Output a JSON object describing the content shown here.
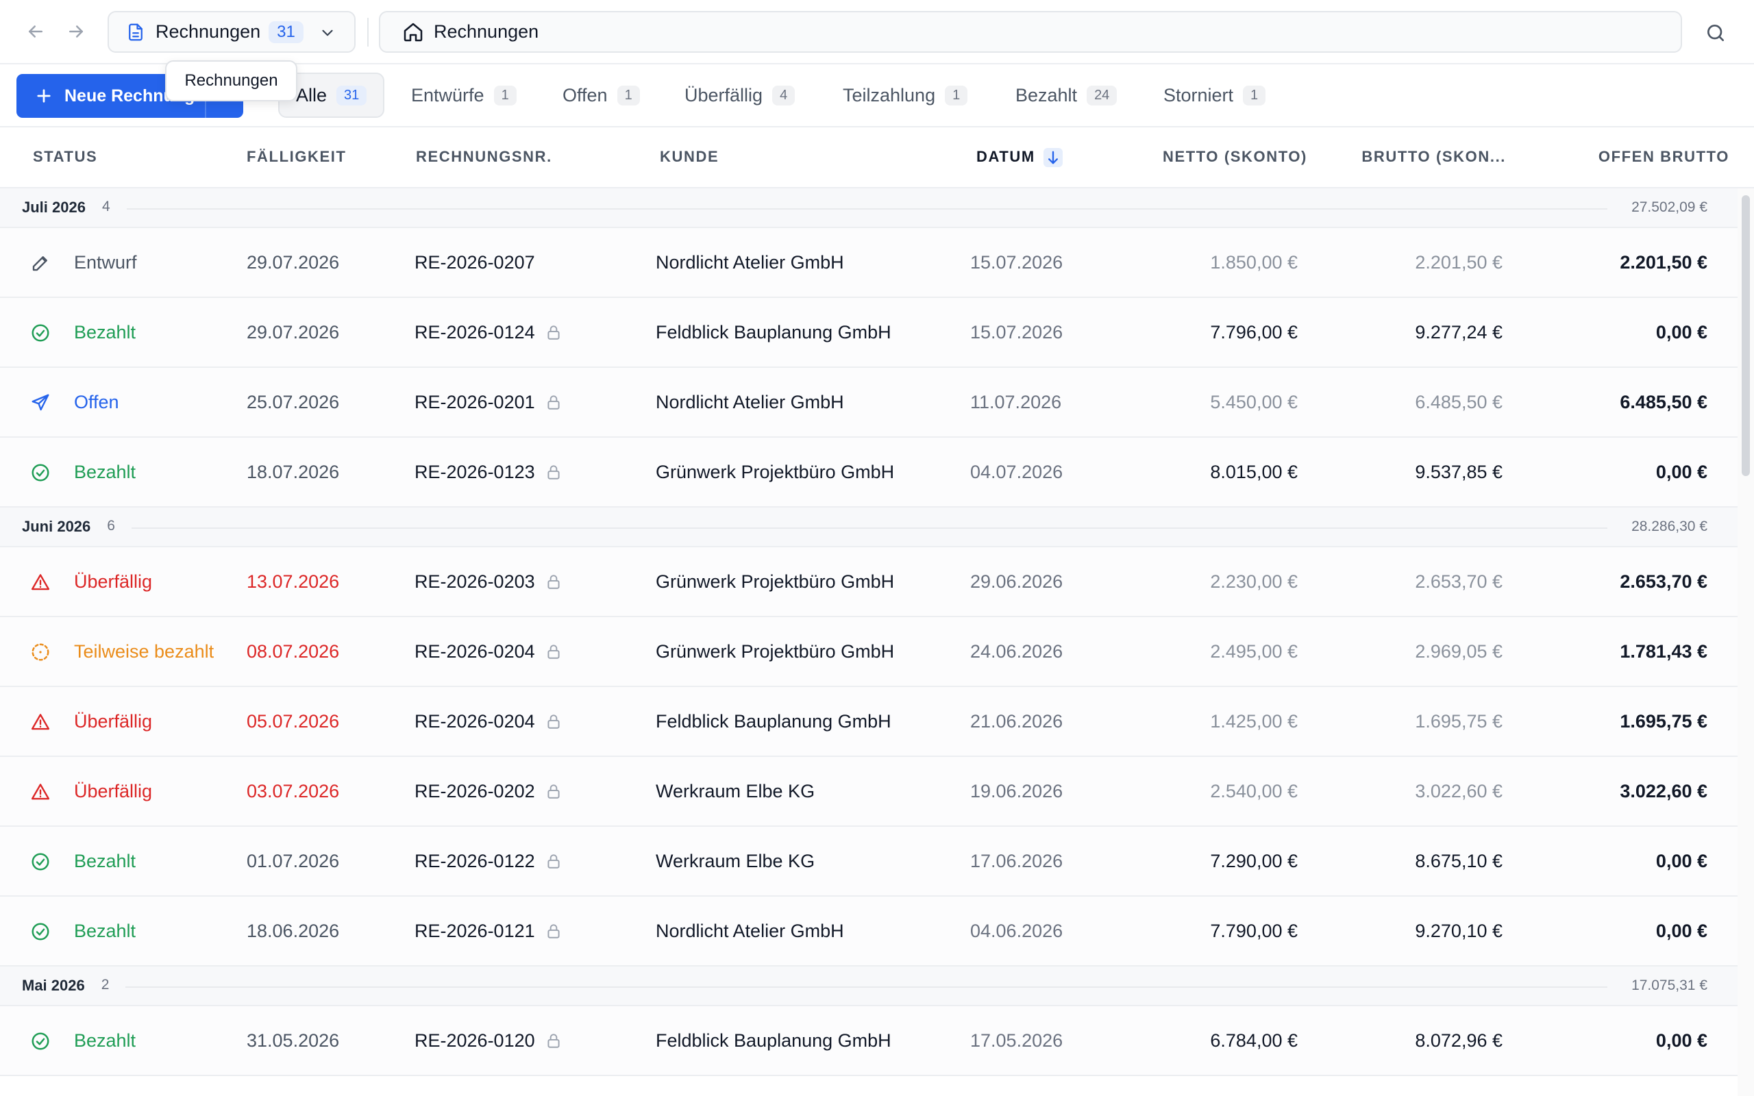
{
  "topbar": {
    "doc_label": "Rechnungen",
    "doc_count": "31",
    "breadcrumb": "Rechnungen"
  },
  "toolbar": {
    "new_button_label": "Neue Rechnung",
    "tooltip": "Rechnungen"
  },
  "tabs": [
    {
      "label": "Alle",
      "count": "31"
    },
    {
      "label": "Entwürfe",
      "count": "1"
    },
    {
      "label": "Offen",
      "count": "1"
    },
    {
      "label": "Überfällig",
      "count": "4"
    },
    {
      "label": "Teilzahlung",
      "count": "1"
    },
    {
      "label": "Bezahlt",
      "count": "24"
    },
    {
      "label": "Storniert",
      "count": "1"
    }
  ],
  "columns": {
    "status": "STATUS",
    "due": "FÄLLIGKEIT",
    "invno": "RECHNUNGSNR.",
    "customer": "KUNDE",
    "date": "DATUM",
    "netto": "NETTO (SKONTO)",
    "brutto": "BRUTTO (SKON...",
    "offen": "OFFEN BRUTTO"
  },
  "colors": {
    "accent": "#2563eb",
    "paid": "#1f9d55",
    "overdue": "#dc2626",
    "partial": "#ea8c1a",
    "draft": "#4b5563"
  },
  "groups": [
    {
      "name": "Juli 2026",
      "count": "4",
      "sum": "27.502,09 €"
    },
    {
      "name": "Juni 2026",
      "count": "6",
      "sum": "28.286,30 €"
    },
    {
      "name": "Mai 2026",
      "count": "2",
      "sum": "17.075,31 €"
    }
  ],
  "rows": [
    {
      "status": "Entwurf",
      "icon": "pencil-icon",
      "due": "29.07.2026",
      "invno": "RE-2026-0207",
      "customer": "Nordlicht Atelier GmbH",
      "date": "15.07.2026",
      "netto": "1.850,00 €",
      "brutto": "2.201,50 €",
      "offen": "2.201,50 €"
    },
    {
      "status": "Bezahlt",
      "icon": "check-circle-icon",
      "due": "29.07.2026",
      "invno": "RE-2026-0124",
      "customer": "Feldblick Bauplanung GmbH",
      "date": "15.07.2026",
      "netto": "7.796,00 €",
      "brutto": "9.277,24 €",
      "offen": "0,00 €"
    },
    {
      "status": "Offen",
      "icon": "send-icon",
      "due": "25.07.2026",
      "invno": "RE-2026-0201",
      "customer": "Nordlicht Atelier GmbH",
      "date": "11.07.2026",
      "netto": "5.450,00 €",
      "brutto": "6.485,50 €",
      "offen": "6.485,50 €"
    },
    {
      "status": "Bezahlt",
      "icon": "check-circle-icon",
      "due": "18.07.2026",
      "invno": "RE-2026-0123",
      "customer": "Grünwerk Projektbüro GmbH",
      "date": "04.07.2026",
      "netto": "8.015,00 €",
      "brutto": "9.537,85 €",
      "offen": "0,00 €"
    },
    {
      "status": "Überfällig",
      "icon": "warning-triangle-icon",
      "due": "13.07.2026",
      "invno": "RE-2026-0203",
      "customer": "Grünwerk Projektbüro GmbH",
      "date": "29.06.2026",
      "netto": "2.230,00 €",
      "brutto": "2.653,70 €",
      "offen": "2.653,70 €"
    },
    {
      "status": "Teilweise bezahlt",
      "icon": "dashed-circle-icon",
      "due": "08.07.2026",
      "invno": "RE-2026-0204",
      "customer": "Grünwerk Projektbüro GmbH",
      "date": "24.06.2026",
      "netto": "2.495,00 €",
      "brutto": "2.969,05 €",
      "offen": "1.781,43 €"
    },
    {
      "status": "Überfällig",
      "icon": "warning-triangle-icon",
      "due": "05.07.2026",
      "invno": "RE-2026-0204",
      "customer": "Feldblick Bauplanung GmbH",
      "date": "21.06.2026",
      "netto": "1.425,00 €",
      "brutto": "1.695,75 €",
      "offen": "1.695,75 €"
    },
    {
      "status": "Überfällig",
      "icon": "warning-triangle-icon",
      "due": "03.07.2026",
      "invno": "RE-2026-0202",
      "customer": "Werkraum Elbe KG",
      "date": "19.06.2026",
      "netto": "2.540,00 €",
      "brutto": "3.022,60 €",
      "offen": "3.022,60 €"
    },
    {
      "status": "Bezahlt",
      "icon": "check-circle-icon",
      "due": "01.07.2026",
      "invno": "RE-2026-0122",
      "customer": "Werkraum Elbe KG",
      "date": "17.06.2026",
      "netto": "7.290,00 €",
      "brutto": "8.675,10 €",
      "offen": "0,00 €"
    },
    {
      "status": "Bezahlt",
      "icon": "check-circle-icon",
      "due": "18.06.2026",
      "invno": "RE-2026-0121",
      "customer": "Nordlicht Atelier GmbH",
      "date": "04.06.2026",
      "netto": "7.790,00 €",
      "brutto": "9.270,10 €",
      "offen": "0,00 €"
    },
    {
      "status": "Bezahlt",
      "icon": "check-circle-icon",
      "due": "31.05.2026",
      "invno": "RE-2026-0120",
      "customer": "Feldblick Bauplanung GmbH",
      "date": "17.05.2026",
      "netto": "6.784,00 €",
      "brutto": "8.072,96 €",
      "offen": "0,00 €"
    }
  ]
}
